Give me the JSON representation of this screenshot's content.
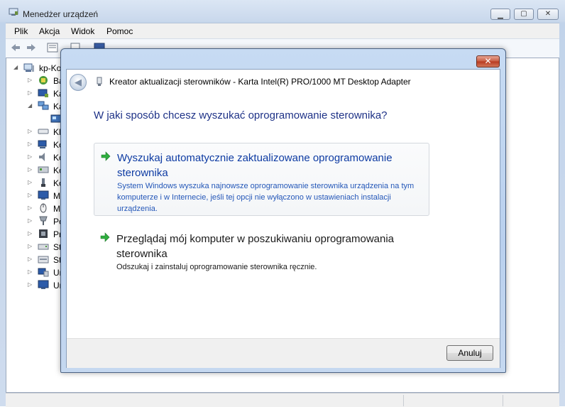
{
  "device_manager": {
    "title": "Menedżer urządzeń",
    "menu": [
      "Plik",
      "Akcja",
      "Widok",
      "Pomoc"
    ],
    "tree": [
      {
        "label": "kp-Ko",
        "icon": "computer-icon",
        "expanded": true
      },
      {
        "label": "Ba",
        "icon": "battery-icon"
      },
      {
        "label": "Ka",
        "icon": "display-adapter-icon"
      },
      {
        "label": "Ka",
        "icon": "network-adapter-icon",
        "expanded": true
      },
      {
        "label": "",
        "icon": "network-card-icon"
      },
      {
        "label": "Kl",
        "icon": "keyboard-icon"
      },
      {
        "label": "Ko",
        "icon": "computer-icon"
      },
      {
        "label": "Ko",
        "icon": "sound-icon"
      },
      {
        "label": "Ko",
        "icon": "ide-controller-icon"
      },
      {
        "label": "Ko",
        "icon": "usb-controller-icon"
      },
      {
        "label": "M",
        "icon": "monitor-icon"
      },
      {
        "label": "M",
        "icon": "mouse-icon"
      },
      {
        "label": "Po",
        "icon": "port-icon"
      },
      {
        "label": "Pr",
        "icon": "processor-icon"
      },
      {
        "label": "St",
        "icon": "disk-drive-icon"
      },
      {
        "label": "St",
        "icon": "storage-controller-icon"
      },
      {
        "label": "Ur",
        "icon": "system-device-icon"
      },
      {
        "label": "Ur",
        "icon": "display-device-icon"
      }
    ]
  },
  "wizard": {
    "header_title": "Kreator aktualizacji sterowników - Karta Intel(R) PRO/1000 MT Desktop Adapter",
    "question": "W jaki sposób chcesz wyszukać oprogramowanie sterownika?",
    "option_auto": {
      "title": "Wyszukaj automatycznie zaktualizowane oprogramowanie sterownika",
      "description": "System Windows wyszuka najnowsze oprogramowanie sterownika urządzenia na tym komputerze i w Internecie, jeśli tej opcji nie wyłączono w ustawieniach instalacji urządzenia."
    },
    "option_browse": {
      "title": "Przeglądaj mój komputer w poszukiwaniu oprogramowania sterownika",
      "description": "Odszukaj i zainstaluj oprogramowanie sterownika ręcznie."
    },
    "cancel_label": "Anuluj"
  },
  "colors": {
    "question": "#1e3287",
    "link_title": "#0e3ba3",
    "link_description": "#2457b8",
    "arrow": "#2fae3f"
  }
}
